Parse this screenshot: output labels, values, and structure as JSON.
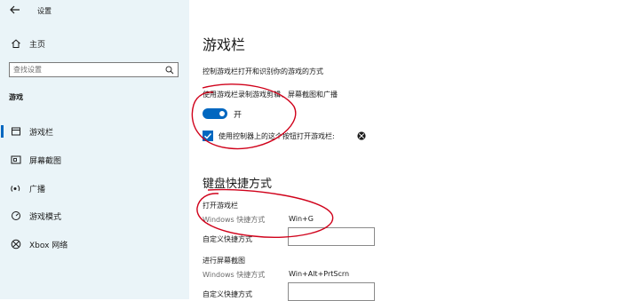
{
  "window": {
    "title": "设置"
  },
  "sidebar": {
    "home_label": "主页",
    "search_placeholder": "查找设置",
    "section": "游戏",
    "items": [
      {
        "label": "游戏栏",
        "icon": "game-bar-icon",
        "active": true
      },
      {
        "label": "屏幕截图",
        "icon": "capture-icon",
        "active": false
      },
      {
        "label": "广播",
        "icon": "broadcast-icon",
        "active": false
      },
      {
        "label": "游戏模式",
        "icon": "game-mode-icon",
        "active": false
      },
      {
        "label": "Xbox 网络",
        "icon": "xbox-icon",
        "active": false
      }
    ]
  },
  "main": {
    "title": "游戏栏",
    "description": "控制游戏栏打开和识别你的游戏的方式",
    "record_label": "使用游戏栏录制游戏剪辑、屏幕截图和广播",
    "toggle_state": "开",
    "toggle_on": true,
    "controller_checkbox_label": "使用控制器上的这个按钮打开游戏栏:",
    "controller_checked": true,
    "keyboard_title": "键盘快捷方式",
    "shortcut_groups": [
      {
        "title": "打开游戏栏",
        "windows_label": "Windows 快捷方式",
        "windows_value": "Win+G",
        "custom_label": "自定义快捷方式",
        "custom_value": ""
      },
      {
        "title": "进行屏幕截图",
        "windows_label": "Windows 快捷方式",
        "windows_value": "Win+Alt+PrtScrn",
        "custom_label": "自定义快捷方式",
        "custom_value": ""
      }
    ]
  },
  "colors": {
    "accent": "#0067c0",
    "sidebar_bg": "#eaf4f8",
    "annotation": "#d0021b"
  }
}
